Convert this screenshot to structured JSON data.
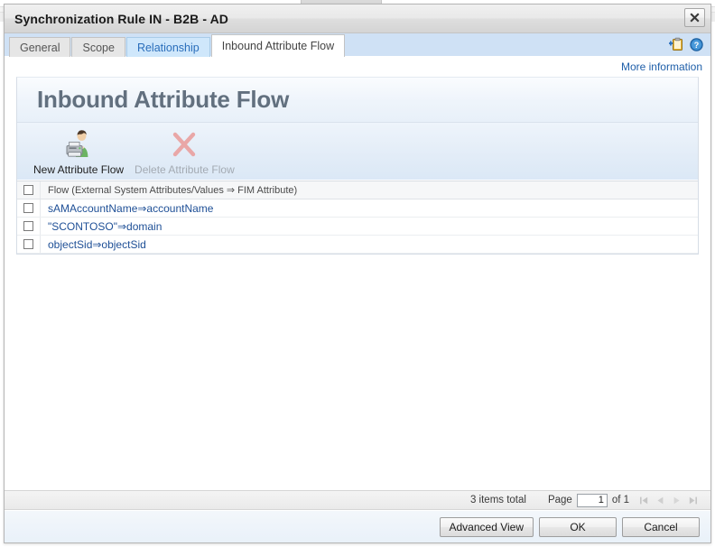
{
  "window": {
    "title": "Synchronization Rule IN - B2B - AD",
    "close_label": "Close",
    "close_icon": "close-icon"
  },
  "tabs": [
    {
      "label": "General",
      "state": "normal"
    },
    {
      "label": "Scope",
      "state": "normal"
    },
    {
      "label": "Relationship",
      "state": "hover"
    },
    {
      "label": "Inbound Attribute Flow",
      "state": "active"
    }
  ],
  "tab_tools": [
    {
      "name": "add-to-clipboard-icon",
      "title": "Add to clipboard"
    },
    {
      "name": "help-icon",
      "title": "Help"
    }
  ],
  "more_information": {
    "label": "More information"
  },
  "page": {
    "heading": "Inbound Attribute Flow"
  },
  "toolbar": {
    "buttons": [
      {
        "label": "New Attribute Flow",
        "icon": "new-attribute-flow-icon",
        "disabled": false
      },
      {
        "label": "Delete Attribute Flow",
        "icon": "delete-attribute-flow-icon",
        "disabled": true
      }
    ]
  },
  "grid": {
    "header": {
      "column": "Flow (External System Attributes/Values ⇒ FIM Attribute)",
      "select_all_checked": false
    },
    "rows": [
      {
        "flow": "sAMAccountName⇒accountName",
        "checked": false
      },
      {
        "flow": "\"SCONTOSO\"⇒domain",
        "checked": false
      },
      {
        "flow": "objectSid⇒objectSid",
        "checked": false
      }
    ]
  },
  "status": {
    "items_total": "3 items total",
    "page_label": "Page",
    "page_value": "1",
    "of_label": "of 1",
    "nav": [
      {
        "name": "first-page-button",
        "glyph": "first",
        "disabled": true
      },
      {
        "name": "previous-page-button",
        "glyph": "prev",
        "disabled": true
      },
      {
        "name": "next-page-button",
        "glyph": "next",
        "disabled": true
      },
      {
        "name": "last-page-button",
        "glyph": "last",
        "disabled": true
      }
    ]
  },
  "footer": {
    "advanced_view": "Advanced View",
    "ok": "OK",
    "cancel": "Cancel"
  },
  "colors": {
    "accent_blue": "#1e4f96",
    "tabstrip_blue": "#cfe1f5",
    "heading_gray": "#62707f",
    "link_blue": "#1f5fa9",
    "delete_x": "#e8a3a3"
  }
}
